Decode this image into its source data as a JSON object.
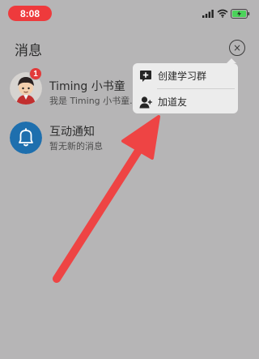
{
  "status_bar": {
    "time": "8:08",
    "time_pill_color": "#ee3a3c",
    "icons": [
      "signal-icon",
      "wifi-icon",
      "battery-charging-icon"
    ]
  },
  "header": {
    "title": "消息",
    "close_glyph": "×"
  },
  "messages": [
    {
      "name": "Timing 小书童",
      "preview": "我是 Timing 小书童.",
      "unread": "1",
      "avatar": "cartoon-boy-avatar"
    },
    {
      "name": "互动通知",
      "preview": "暂无新的消息",
      "avatar": "bell-avatar"
    }
  ],
  "popup_menu": {
    "items": [
      {
        "label": "创建学习群",
        "icon": "plus-chat-icon"
      },
      {
        "label": "加道友",
        "icon": "add-user-icon"
      }
    ]
  },
  "overlay": {
    "annotation": "red-arrow",
    "annotation_color": "#ee4444",
    "dim_background": "#b6b5b6"
  }
}
